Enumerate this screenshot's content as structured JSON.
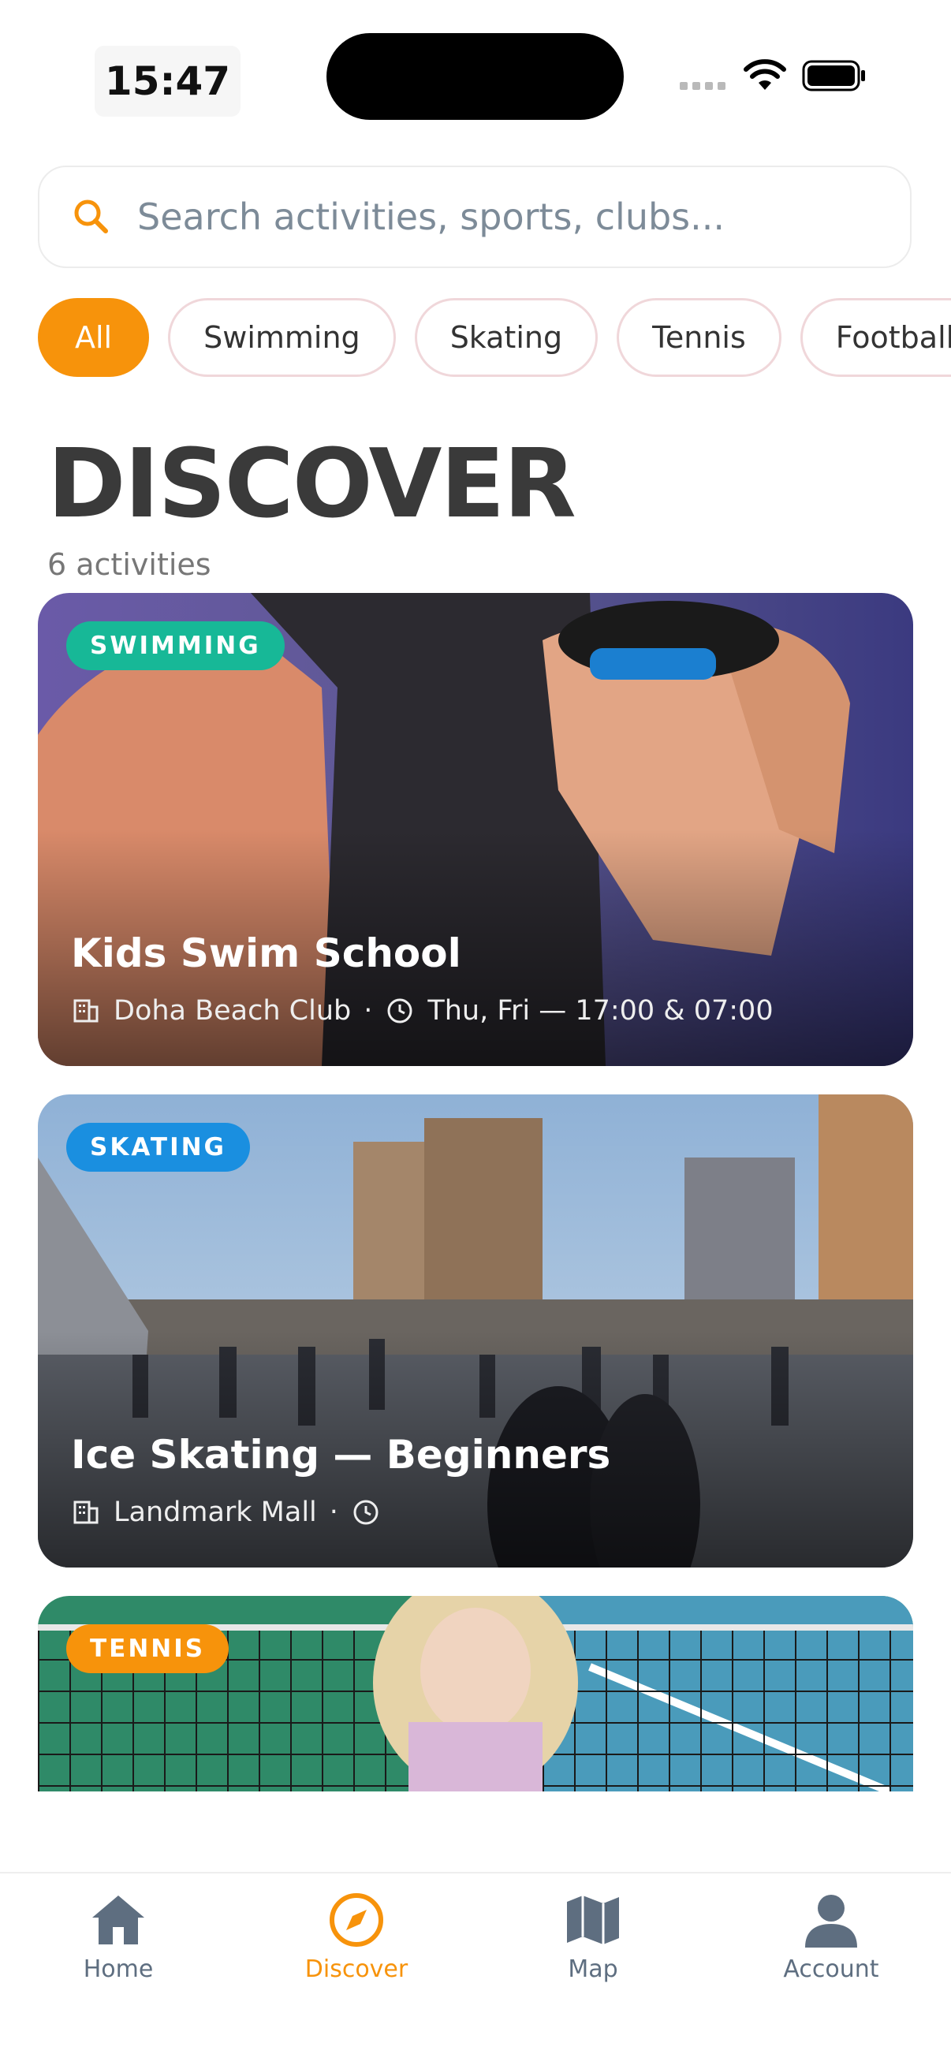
{
  "status_bar": {
    "time": "15:47"
  },
  "search": {
    "placeholder": "Search activities, sports, clubs..."
  },
  "filters": [
    "All",
    "Swimming",
    "Skating",
    "Tennis",
    "Football"
  ],
  "header": {
    "title": "DISCOVER",
    "count": "6 activities"
  },
  "cards": [
    {
      "badge": "SWIMMING",
      "badge_color": "#17b897",
      "title": "Kids Swim School",
      "venue": "Doha Beach Club",
      "schedule": "Thu, Fri — 17:00 & 07:00"
    },
    {
      "badge": "SKATING",
      "badge_color": "#1a8fe0",
      "title": "Ice Skating — Beginners",
      "venue": "Landmark Mall",
      "schedule": ""
    },
    {
      "badge": "TENNIS",
      "badge_color": "#f7930b"
    }
  ],
  "nav": {
    "home": "Home",
    "discover": "Discover",
    "map": "Map",
    "account": "Account"
  },
  "colors": {
    "accent": "#f7930b",
    "nav_inactive": "#5e6e80"
  }
}
